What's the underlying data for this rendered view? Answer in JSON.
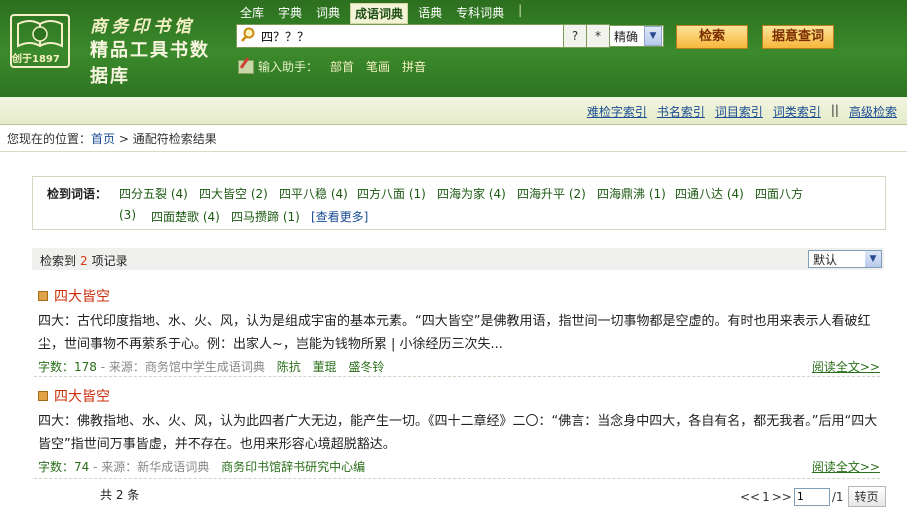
{
  "logo": {
    "line1": "商务印书馆",
    "line2": "精品工具书数据库",
    "est": "创于1897"
  },
  "db_tabs": [
    {
      "label": "全库"
    },
    {
      "label": "字典"
    },
    {
      "label": "词典"
    },
    {
      "label": "成语词典",
      "active": true
    },
    {
      "label": "语典"
    },
    {
      "label": "专科词典"
    }
  ],
  "db_sep": "|",
  "search": {
    "value": "四？？？",
    "wildcard_q": "?",
    "wildcard_star": "*",
    "mode": "精确",
    "submit_label": "检索",
    "free_label": "据意查词"
  },
  "helper": {
    "label": "输入助手：",
    "links": [
      "部首",
      "笔画",
      "拼音"
    ]
  },
  "indexbar": {
    "links": [
      "难检字索引",
      "书名索引",
      "词目索引",
      "词类索引"
    ],
    "sep": "||",
    "advanced": "高级检索"
  },
  "breadcrumb": {
    "prefix": "您现在的位置：",
    "home": "首页",
    "arrow": ">",
    "current": "通配符检索结果"
  },
  "related": {
    "title": "检到词语：",
    "words": [
      {
        "w": "四分五裂",
        "c": "(4)"
      },
      {
        "w": "四大皆空",
        "c": "(2)"
      },
      {
        "w": "四平八稳",
        "c": "(4)"
      },
      {
        "w": "四方八面",
        "c": "(1)"
      },
      {
        "w": "四海为家",
        "c": "(4)"
      },
      {
        "w": "四海升平",
        "c": "(2)"
      },
      {
        "w": "四海鼎沸",
        "c": "(1)"
      },
      {
        "w": "四通八达",
        "c": "(4)"
      },
      {
        "w": "四面八方",
        "c": ""
      },
      {
        "w": "",
        "c": "(3)"
      },
      {
        "w": "四面楚歌",
        "c": "(4)"
      },
      {
        "w": "四马攒蹄",
        "c": "(1)"
      }
    ],
    "more": "[查看更多]"
  },
  "results": {
    "count_prefix": "检索到",
    "count": "2",
    "count_suffix": "项记录",
    "sort_value": "默认",
    "items": [
      {
        "title": "四大皆空",
        "body": "四大：古代印度指地、水、火、风，认为是组成宇宙的基本元素。“四大皆空”是佛教用语，指世间一切事物都是空虚的。有时也用来表示人看破红尘，世间事物不再萦系于心。例：出家人~，岂能为钱物所累 | 小徐经历三次失...",
        "chars_label": "字数：178",
        "source_label": " - 来源：",
        "source": "商务馆中学生成语词典",
        "authors": [
          "陈抗",
          "董琨",
          "盛冬铃"
        ],
        "readmore": "阅读全文>>"
      },
      {
        "title": "四大皆空",
        "body": "四大：佛教指地、水、火、风，认为此四者广大无边，能产生一切。《四十二章经》二〇：“佛言：当念身中四大，各自有名，都无我者。”后用“四大皆空”指世间万事皆虚，并不存在。也用来形容心境超脱豁达。",
        "chars_label": "字数：74",
        "source_label": " - 来源：",
        "source": "新华成语词典",
        "authors": [
          "商务印书馆辞书研究中心编"
        ],
        "readmore": "阅读全文>>"
      }
    ]
  },
  "pager": {
    "total": "共 2 条",
    "prev": "<<",
    "current": "1",
    "next": ">>",
    "input_value": "1",
    "of": "/1",
    "go": "转页"
  },
  "colors": {
    "header_green": "#3b8a2b",
    "link_blue": "#1b4c94",
    "title_red": "#cc2f0c",
    "button_orange": "#f6b73c"
  }
}
